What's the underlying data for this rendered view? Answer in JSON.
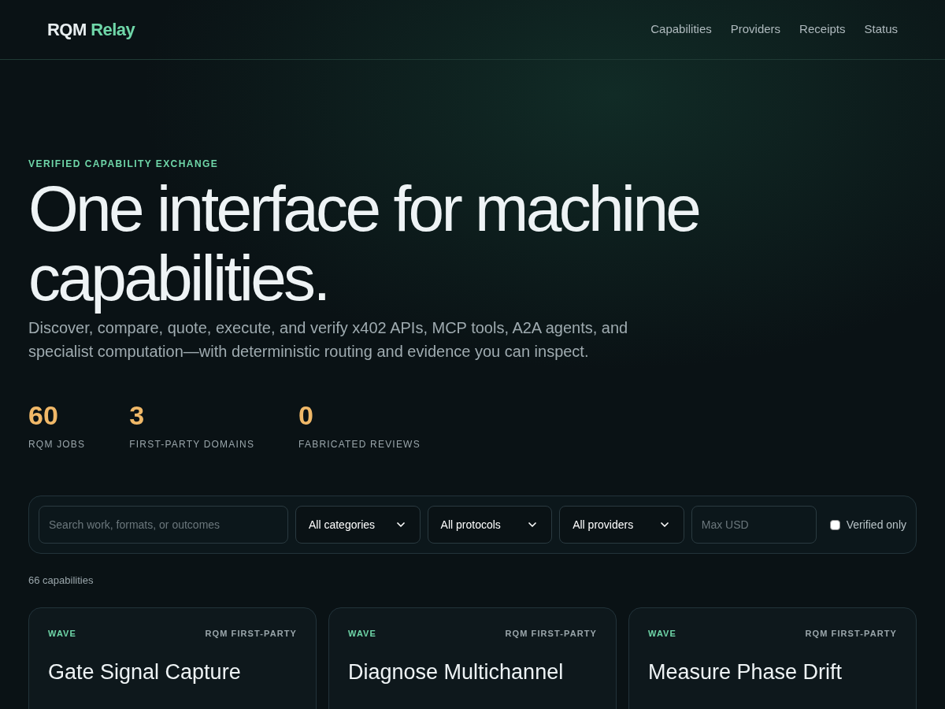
{
  "brand": {
    "name": "RQM",
    "accent": "Relay"
  },
  "nav": [
    "Capabilities",
    "Providers",
    "Receipts",
    "Status"
  ],
  "hero": {
    "eyebrow": "VERIFIED CAPABILITY EXCHANGE",
    "title": "One interface for machine capabilities.",
    "subtitle": "Discover, compare, quote, execute, and verify x402 APIs, MCP tools, A2A agents, and specialist computation—with deterministic routing and evidence you can inspect."
  },
  "stats": [
    {
      "value": "60",
      "label": "RQM JOBS"
    },
    {
      "value": "3",
      "label": "FIRST-PARTY DOMAINS"
    },
    {
      "value": "0",
      "label": "FABRICATED REVIEWS"
    }
  ],
  "filters": {
    "search": {
      "placeholder": "Search work, formats, or outcomes"
    },
    "selects": [
      "All categories",
      "All protocols",
      "All providers"
    ],
    "max": {
      "placeholder": "Max USD"
    },
    "verified": {
      "label": "Verified only",
      "checked": false
    }
  },
  "count": "66 capabilities",
  "cards": [
    {
      "category": "WAVE",
      "provider": "RQM FIRST-PARTY",
      "title": "Gate Signal Capture"
    },
    {
      "category": "WAVE",
      "provider": "RQM FIRST-PARTY",
      "title": "Diagnose Multichannel"
    },
    {
      "category": "WAVE",
      "provider": "RQM FIRST-PARTY",
      "title": "Measure Phase Drift"
    }
  ]
}
